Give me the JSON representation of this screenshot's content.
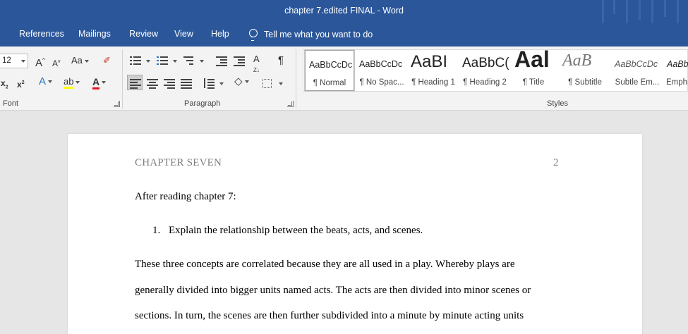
{
  "window": {
    "title": "chapter 7.edited FINAL  -  Word"
  },
  "menu": {
    "items": [
      "References",
      "Mailings",
      "Review",
      "View",
      "Help"
    ],
    "tell_me": "Tell me what you want to do"
  },
  "ribbon": {
    "font": {
      "size": "12",
      "group_label": "Font",
      "grow": "A",
      "shrink": "A",
      "case": "Aa",
      "subscript": "x",
      "superscript": "x"
    },
    "paragraph": {
      "group_label": "Paragraph",
      "pilcrow": "¶"
    },
    "styles": {
      "group_label": "Styles",
      "items": [
        {
          "preview": "AaBbCcDc",
          "label": "¶ Normal"
        },
        {
          "preview": "AaBbCcDc",
          "label": "¶ No Spac..."
        },
        {
          "preview": "AaBI",
          "label": "¶ Heading 1"
        },
        {
          "preview": "AaBbC(",
          "label": "¶ Heading 2"
        },
        {
          "preview": "Aal",
          "label": "¶ Title"
        },
        {
          "preview": "AaB",
          "label": "¶ Subtitle"
        },
        {
          "preview": "AaBbCcDc",
          "label": "Subtle Em..."
        },
        {
          "preview": "AaBbCcDc",
          "label": "Emph"
        }
      ]
    }
  },
  "document": {
    "header_text": "CHAPTER SEVEN",
    "page_number": "2",
    "intro": "After reading chapter 7:",
    "list_number": "1.",
    "list_item": "Explain the relationship between the beats, acts, and scenes.",
    "lines": [
      "These three concepts are correlated because they are all used in a play. Whereby plays are",
      "generally divided into bigger units named acts. The acts are then divided into minor scenes or",
      "sections. In turn, the scenes are then further subdivided into a minute by minute acting units"
    ]
  },
  "colors": {
    "accent": "#2b579a",
    "ribbon_bg": "#f3f3f3",
    "workspace": "#e6e6e6"
  }
}
